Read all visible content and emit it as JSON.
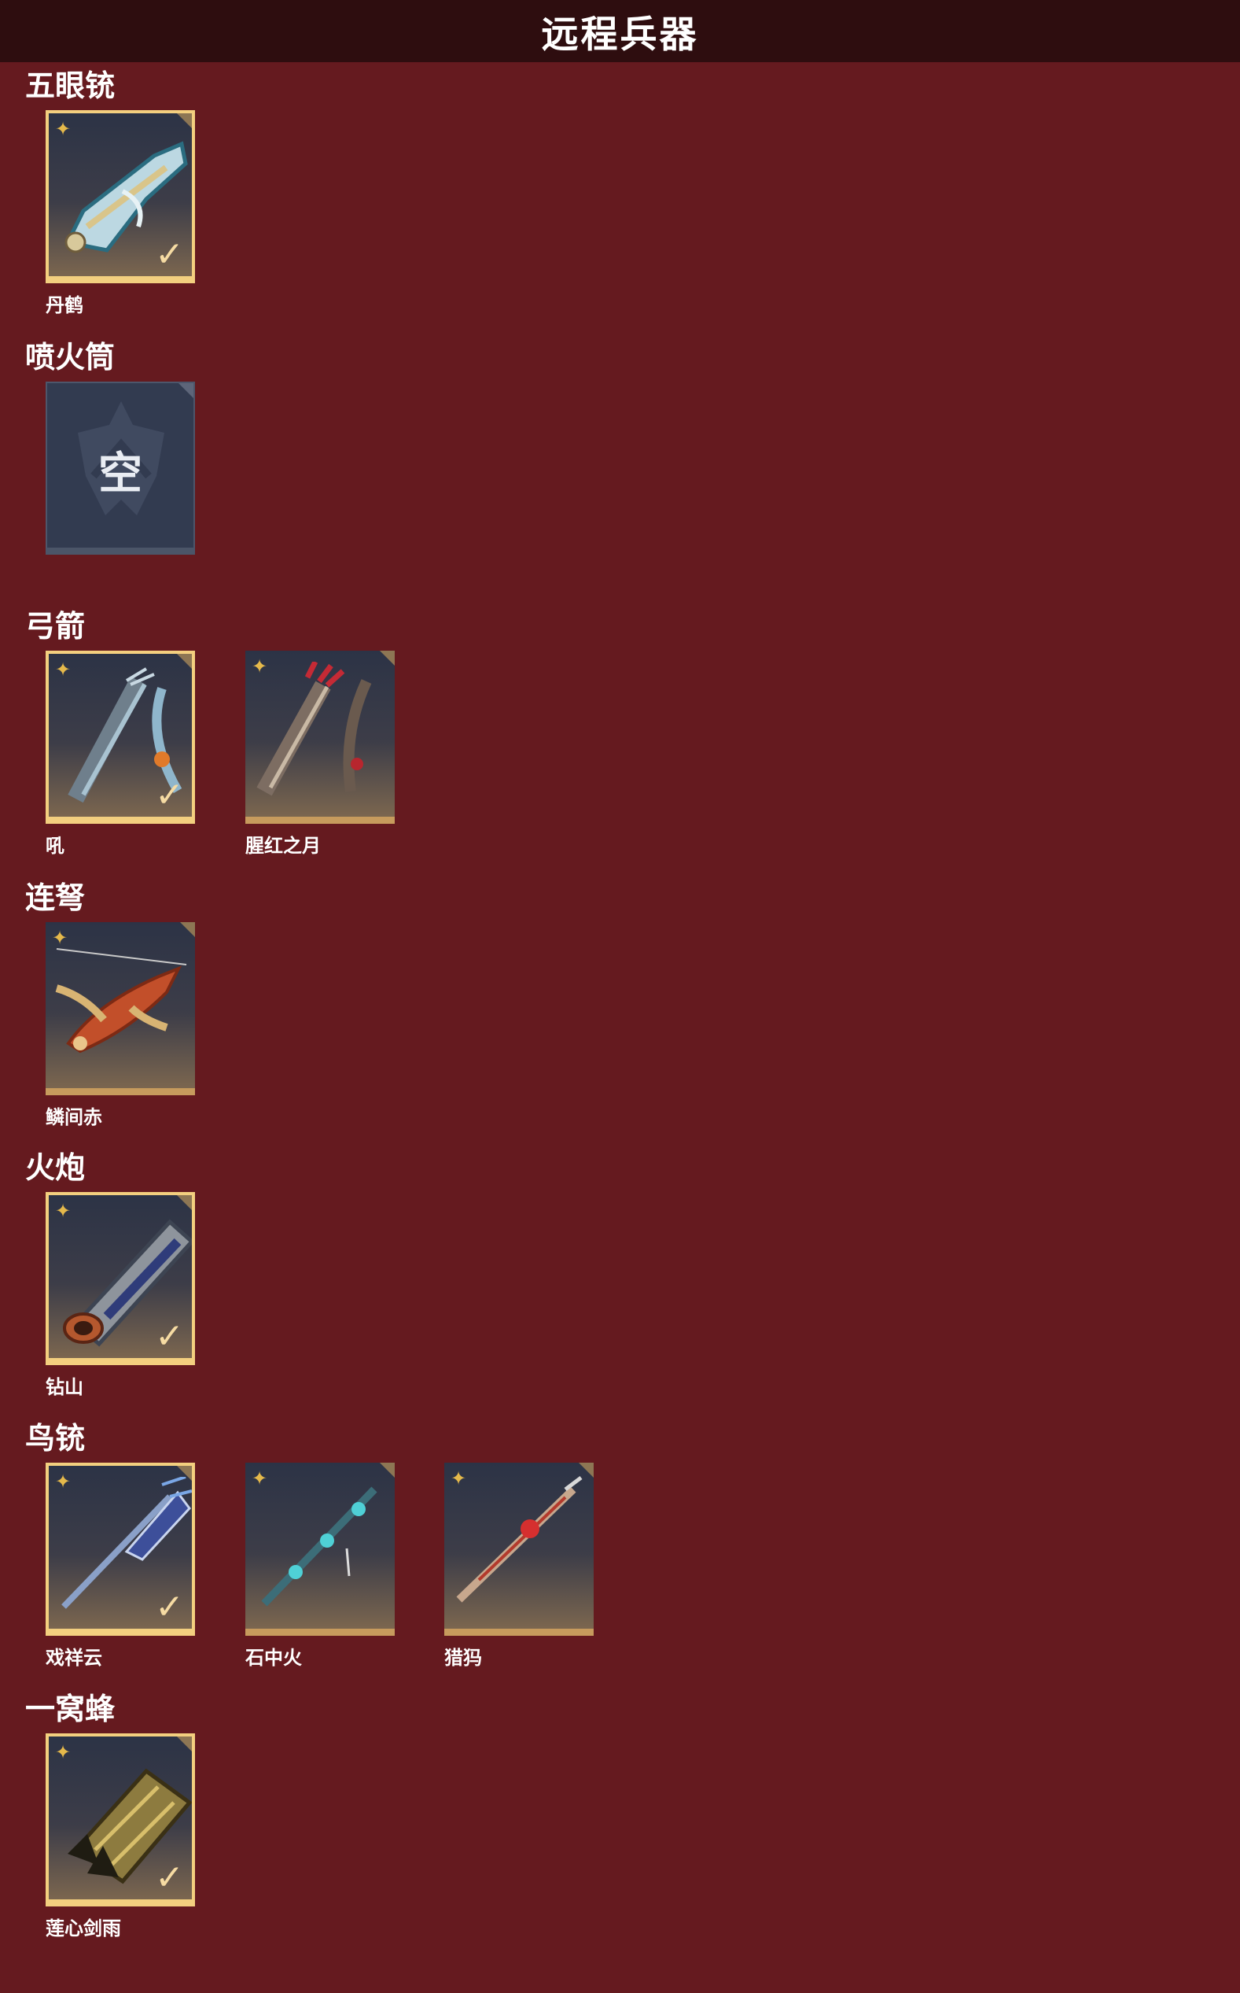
{
  "header": {
    "title": "远程兵器"
  },
  "empty_label": "空",
  "categories": [
    {
      "title": "五眼铳",
      "items": [
        {
          "name": "丹鹤",
          "equipped": true,
          "art": "pistol"
        }
      ]
    },
    {
      "title": "喷火筒",
      "items": [
        {
          "name": "",
          "empty": true
        }
      ]
    },
    {
      "title": "弓箭",
      "items": [
        {
          "name": "吼",
          "equipped": true,
          "art": "bow-blue"
        },
        {
          "name": "腥红之月",
          "equipped": false,
          "art": "bow-red"
        }
      ]
    },
    {
      "title": "连弩",
      "items": [
        {
          "name": "鳞间赤",
          "equipped": false,
          "art": "fish-crossbow"
        }
      ]
    },
    {
      "title": "火炮",
      "items": [
        {
          "name": "钻山",
          "equipped": true,
          "art": "cannon"
        }
      ]
    },
    {
      "title": "鸟铳",
      "items": [
        {
          "name": "戏祥云",
          "equipped": true,
          "art": "rifle-blue"
        },
        {
          "name": "石中火",
          "equipped": false,
          "art": "rifle-teal"
        },
        {
          "name": "猎犸",
          "equipped": false,
          "art": "rifle-red"
        }
      ]
    },
    {
      "title": "一窝蜂",
      "items": [
        {
          "name": "莲心剑雨",
          "equipped": true,
          "art": "hive-launcher"
        }
      ]
    }
  ],
  "colors": {
    "background": "#651a1f",
    "header": "#2e0d0f",
    "equipped_border": "#f3cf7f",
    "rarity": "#e5b94b"
  },
  "icons": {
    "rarity": "four-point-star-icon",
    "equipped": "checkmark-icon",
    "corner": "corner-badge-icon"
  }
}
